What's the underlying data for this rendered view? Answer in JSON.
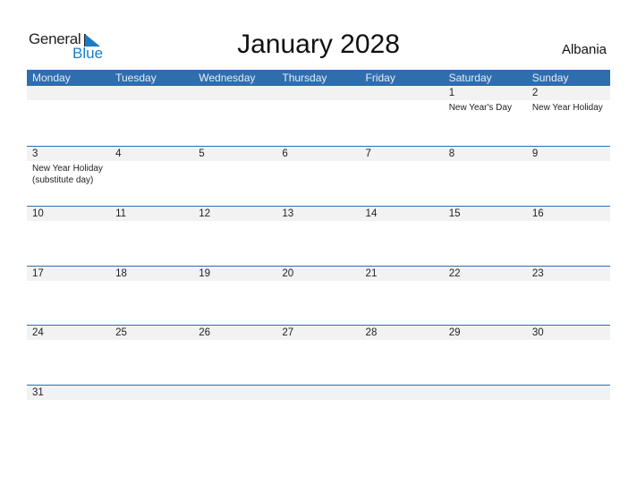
{
  "logo": {
    "general": "General",
    "blue": "Blue"
  },
  "title": "January 2028",
  "country": "Albania",
  "colors": {
    "header": "#2e6ead",
    "strip": "#f2f2f2",
    "logo_blue": "#1a7bc9"
  },
  "weekdays": [
    "Monday",
    "Tuesday",
    "Wednesday",
    "Thursday",
    "Friday",
    "Saturday",
    "Sunday"
  ],
  "weeks": [
    [
      {
        "d": ""
      },
      {
        "d": ""
      },
      {
        "d": ""
      },
      {
        "d": ""
      },
      {
        "d": ""
      },
      {
        "d": "1",
        "ev": "New Year's Day"
      },
      {
        "d": "2",
        "ev": "New Year Holiday"
      }
    ],
    [
      {
        "d": "3",
        "ev": "New Year Holiday (substitute day)"
      },
      {
        "d": "4"
      },
      {
        "d": "5"
      },
      {
        "d": "6"
      },
      {
        "d": "7"
      },
      {
        "d": "8"
      },
      {
        "d": "9"
      }
    ],
    [
      {
        "d": "10"
      },
      {
        "d": "11"
      },
      {
        "d": "12"
      },
      {
        "d": "13"
      },
      {
        "d": "14"
      },
      {
        "d": "15"
      },
      {
        "d": "16"
      }
    ],
    [
      {
        "d": "17"
      },
      {
        "d": "18"
      },
      {
        "d": "19"
      },
      {
        "d": "20"
      },
      {
        "d": "21"
      },
      {
        "d": "22"
      },
      {
        "d": "23"
      }
    ],
    [
      {
        "d": "24"
      },
      {
        "d": "25"
      },
      {
        "d": "26"
      },
      {
        "d": "27"
      },
      {
        "d": "28"
      },
      {
        "d": "29"
      },
      {
        "d": "30"
      }
    ],
    [
      {
        "d": "31"
      },
      {
        "d": ""
      },
      {
        "d": ""
      },
      {
        "d": ""
      },
      {
        "d": ""
      },
      {
        "d": ""
      },
      {
        "d": ""
      }
    ]
  ]
}
